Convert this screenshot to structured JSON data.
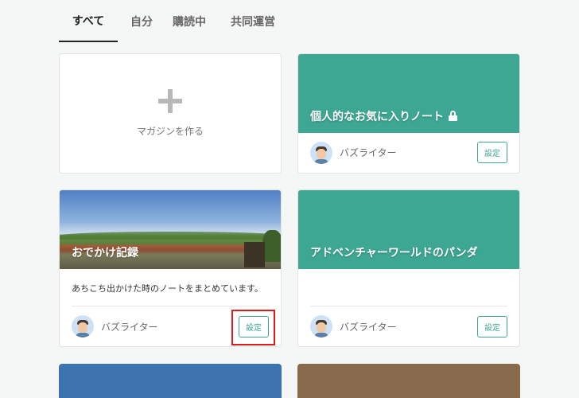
{
  "tabs": [
    {
      "label": "すべて",
      "active": true
    },
    {
      "label": "自分",
      "active": false
    },
    {
      "label": "購読中",
      "active": false
    },
    {
      "label": "共同運営",
      "active": false
    }
  ],
  "new_magazine": {
    "label": "マガジンを作る",
    "icon": "plus-icon"
  },
  "magazines": [
    {
      "title": "個人的なお気に入りノート",
      "private_icon": "lock-icon",
      "cover_color": "#3da793",
      "author": "バズライター",
      "settings_label": "設定"
    },
    {
      "title": "おでかけ記録",
      "cover": "landscape-photo",
      "description": "あちこち出かけた時のノートをまとめています。",
      "author": "バズライター",
      "settings_label": "設定"
    },
    {
      "title": "アドベンチャーワールドのパンダ",
      "cover_color": "#3da793",
      "author": "バズライター",
      "settings_label": "設定"
    }
  ],
  "colors": {
    "accent": "#3da793",
    "highlight": "#e0191b",
    "partial_card_blue": "#3d73ae",
    "partial_card_wood": "#8a6a4c"
  }
}
